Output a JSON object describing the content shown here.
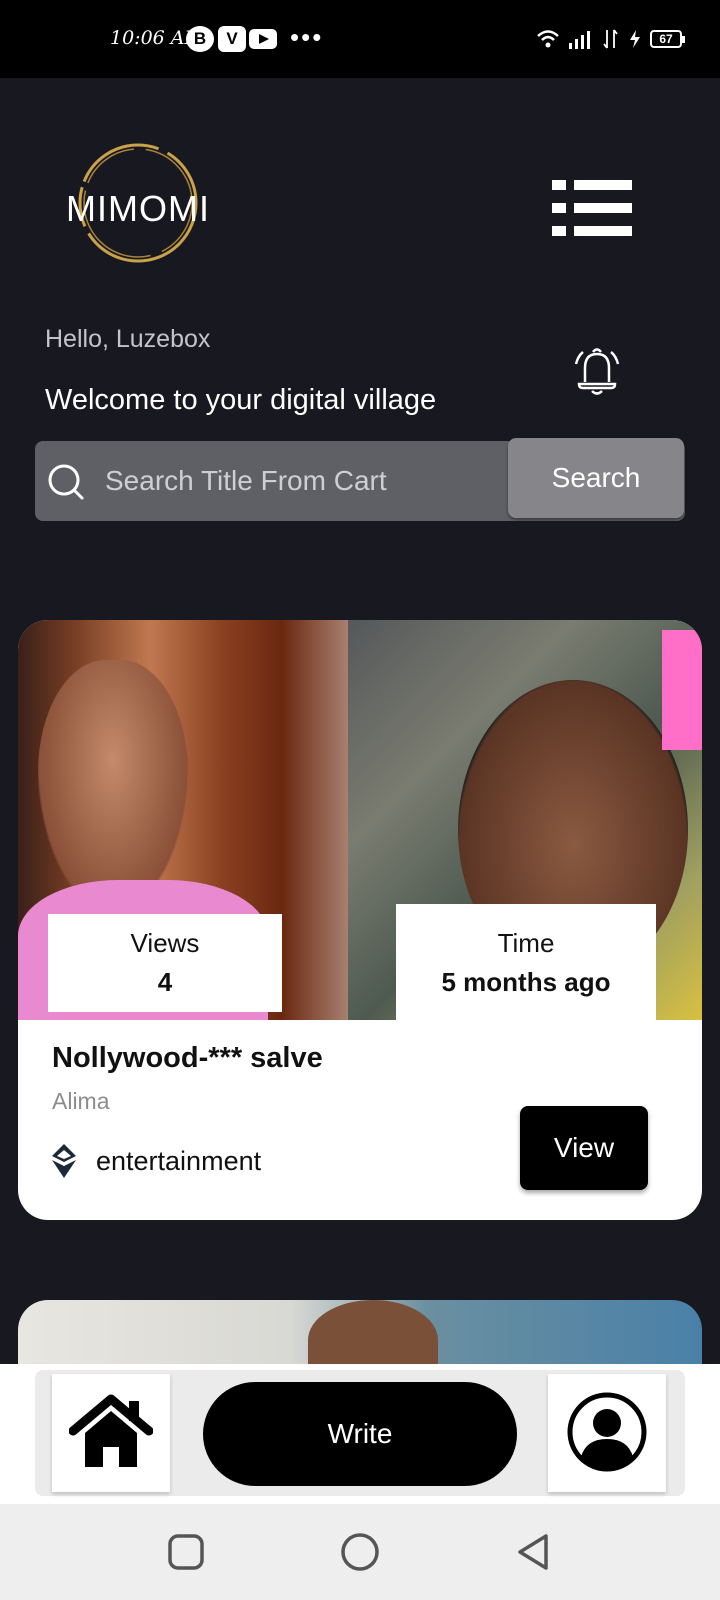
{
  "status_bar": {
    "time": "10:06 AM",
    "badges": [
      "B",
      "V"
    ],
    "more": "•••",
    "battery": "67"
  },
  "header": {
    "logo_text": "MIMOMI"
  },
  "greeting": "Hello, Luzebox",
  "welcome": "Welcome to your digital village",
  "search": {
    "placeholder": "Search Title From Cart",
    "button_label": "Search"
  },
  "post": {
    "views_label": "Views",
    "views_value": "4",
    "time_label": "Time",
    "time_value": "5 months ago",
    "title": "Nollywood-*** salve",
    "author": "Alima",
    "category": "entertainment",
    "view_button": "View"
  },
  "bottom_nav": {
    "write_label": "Write"
  },
  "colors": {
    "background": "#181920",
    "search_box": "#5f6066",
    "search_button": "#85858a",
    "logo_ring": "#c9a24a"
  },
  "icons": {
    "menu": "list-menu-icon",
    "notification": "bell-ringing-icon",
    "search": "search-icon",
    "category": "ethereum-icon",
    "home": "home-icon",
    "profile": "user-avatar-icon"
  }
}
